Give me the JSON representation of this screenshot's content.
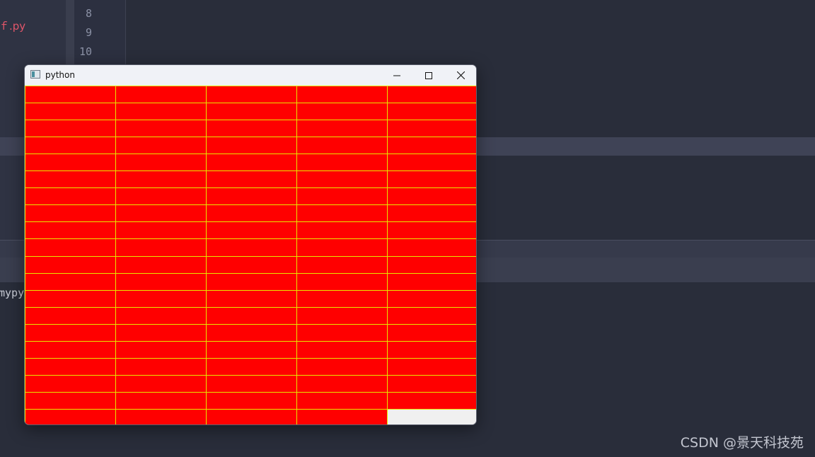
{
  "ide": {
    "sidebar_file": "ｆ.py",
    "gutter_lines": [
      "8",
      "9",
      "10"
    ],
    "terminal_text": "mypy"
  },
  "watermark": "CSDN @景天科技苑",
  "window": {
    "title": "python",
    "icon": "app-window-icon",
    "controls": [
      "minimize-icon",
      "maximize-icon",
      "close-icon"
    ]
  },
  "grid": {
    "columns": 5,
    "rows": 20,
    "filled_cells": 99,
    "cell_color": "#ff0000",
    "border_color": "#e6e600",
    "empty_color": "#f0f0f0"
  }
}
